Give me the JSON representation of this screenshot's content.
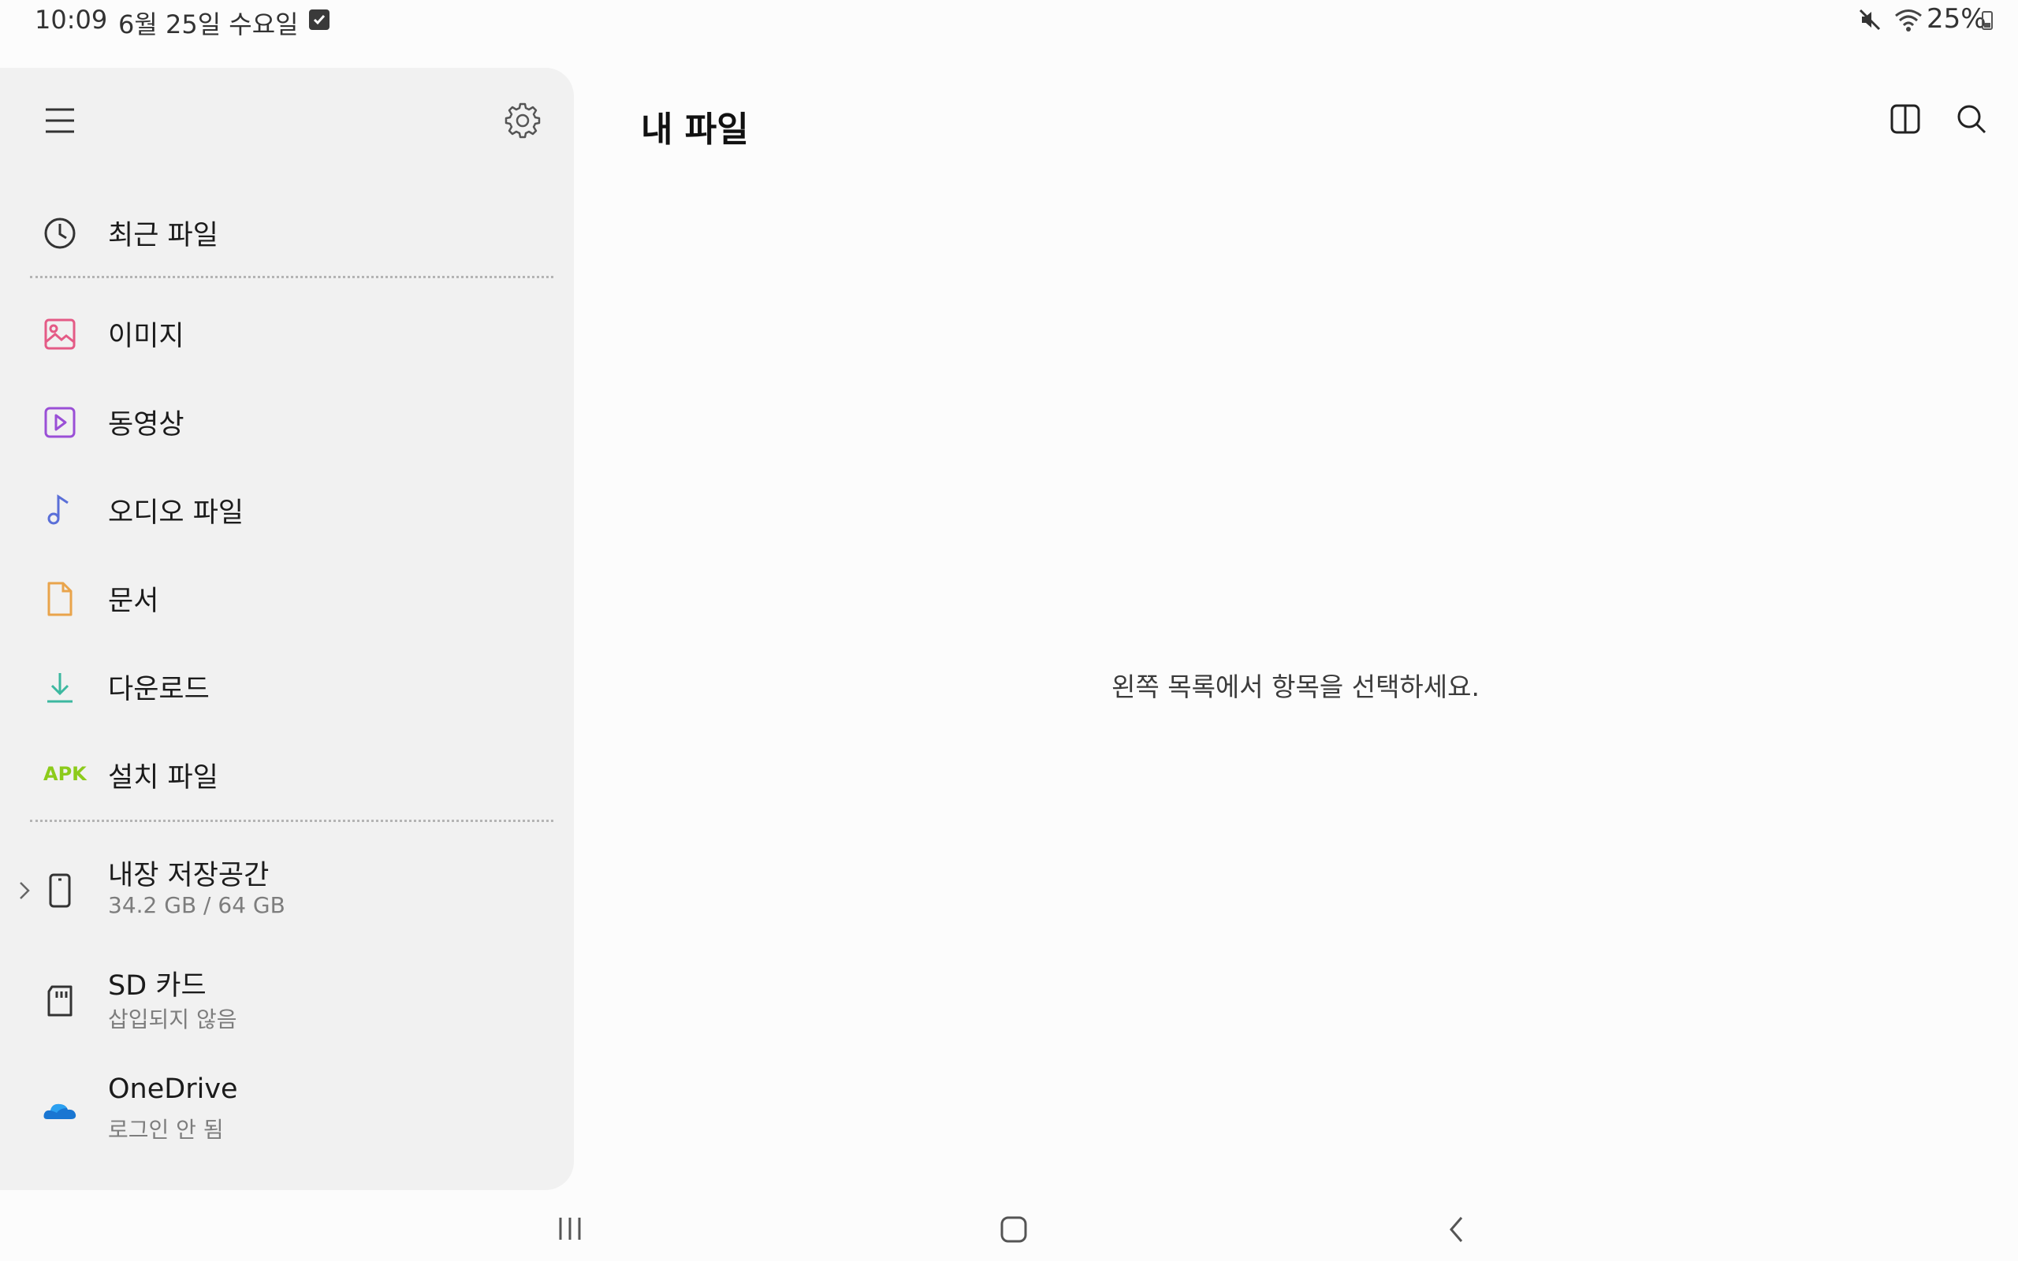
{
  "status_bar": {
    "time": "10:09",
    "date": "6월 25일 수요일",
    "battery": "25%",
    "icons": [
      "checkbox-notification-icon",
      "mute-icon",
      "wifi-icon",
      "battery-icon"
    ]
  },
  "sidebar": {
    "menu_icon": "hamburger-menu-icon",
    "settings_icon": "gear-icon",
    "recent": {
      "label": "최근 파일",
      "icon": "clock-icon"
    },
    "categories": [
      {
        "label": "이미지",
        "icon": "image-icon",
        "color": "#e45b86"
      },
      {
        "label": "동영상",
        "icon": "video-icon",
        "color": "#9a4fd6"
      },
      {
        "label": "오디오 파일",
        "icon": "music-note-icon",
        "color": "#5a6fd8"
      },
      {
        "label": "문서",
        "icon": "document-icon",
        "color": "#e9a44b"
      },
      {
        "label": "다운로드",
        "icon": "download-icon",
        "color": "#3cb8a0"
      },
      {
        "label": "설치 파일",
        "icon_text": "APK",
        "color": "#8ccb1b"
      }
    ],
    "storage": [
      {
        "label": "내장 저장공간",
        "sub": "34.2 GB / 64 GB",
        "icon": "phone-icon",
        "expand_icon": "chevron-right-icon"
      },
      {
        "label": "SD 카드",
        "sub": "삽입되지 않음",
        "icon": "sd-card-icon"
      },
      {
        "label": "OneDrive",
        "sub": "로그인 안 됨",
        "icon": "cloud-icon",
        "color": "#1976d2"
      }
    ]
  },
  "main": {
    "title": "내 파일",
    "split_view_icon": "split-view-icon",
    "search_icon": "search-icon",
    "empty_message": "왼쪽 목록에서 항목을 선택하세요."
  },
  "navbar": {
    "recents_icon": "recents-icon",
    "home_icon": "home-icon",
    "back_icon": "back-icon"
  }
}
